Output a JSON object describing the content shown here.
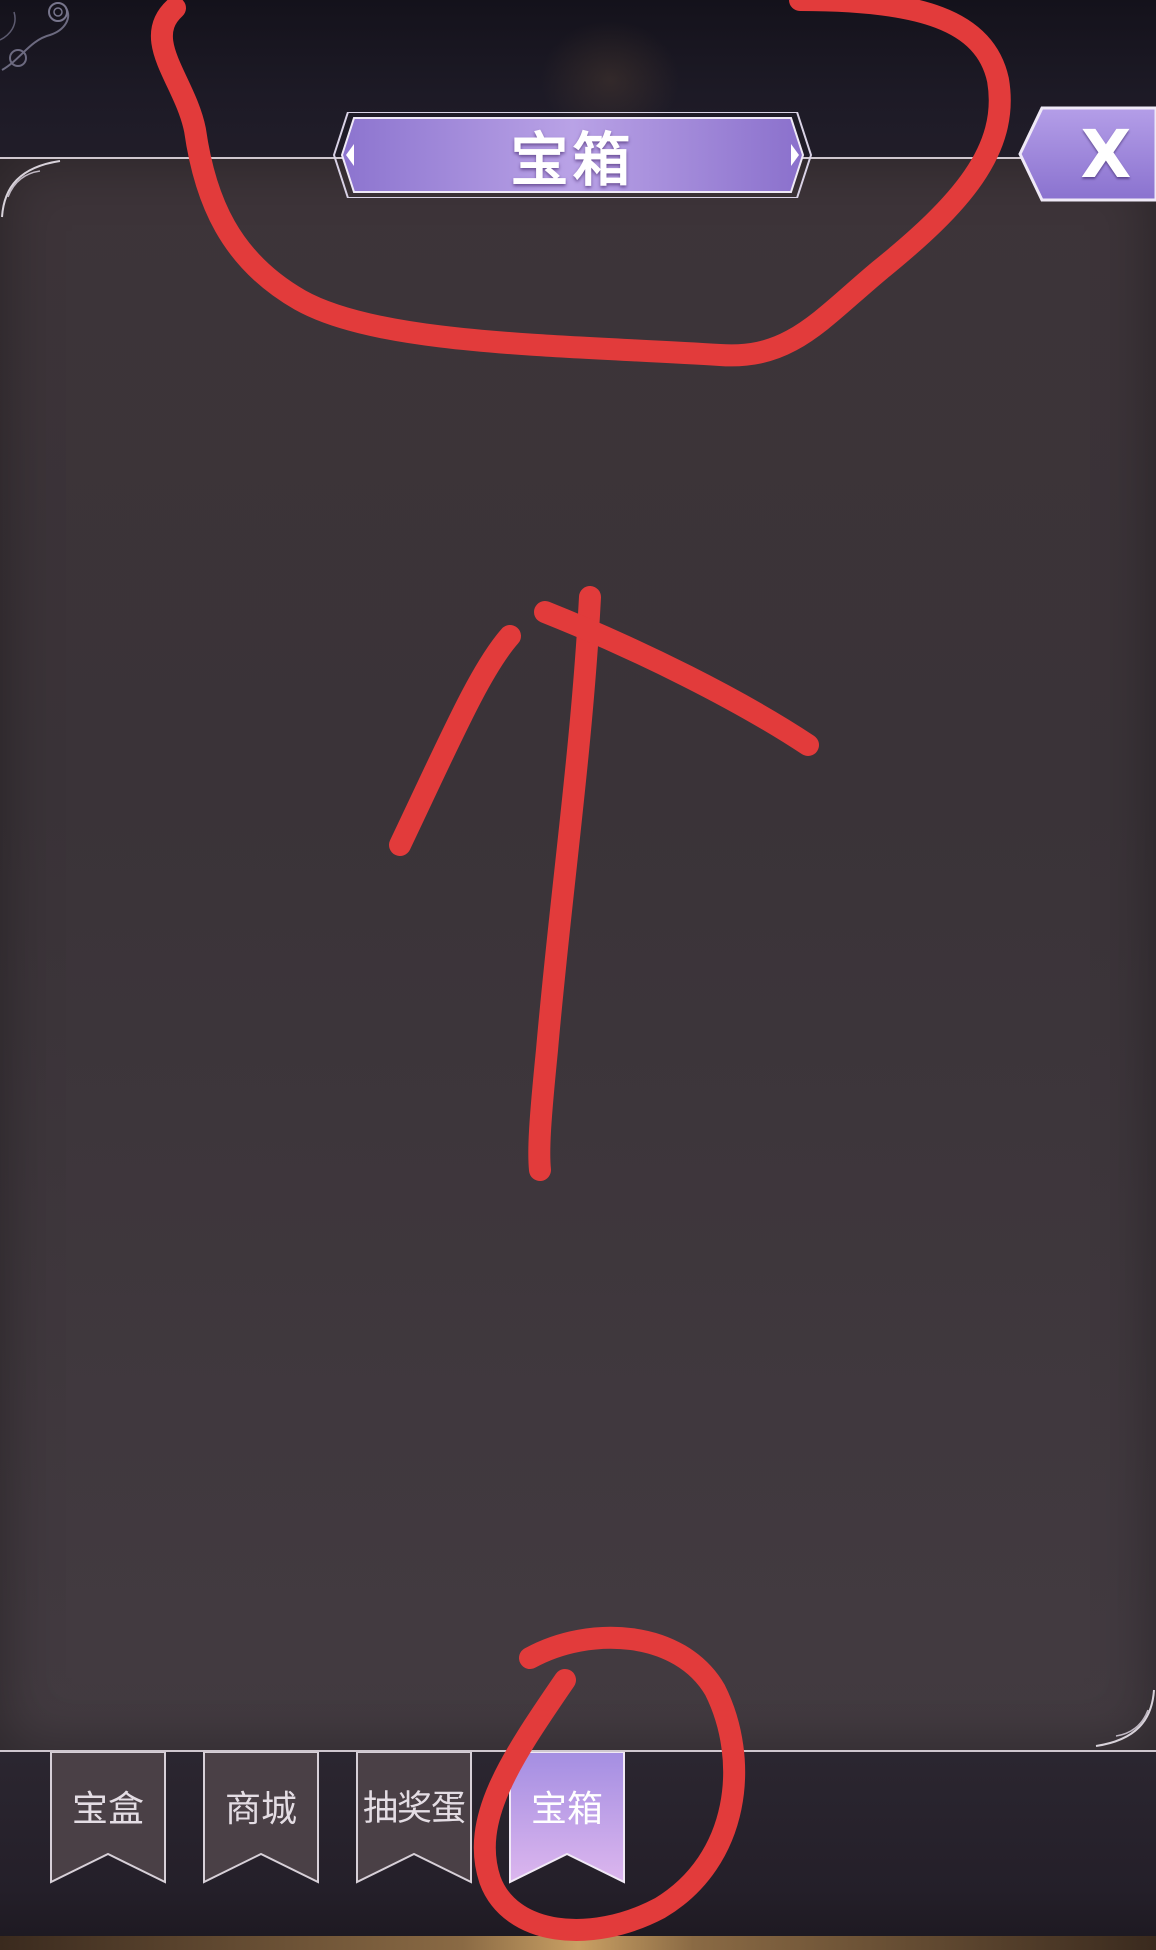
{
  "header": {
    "title": "宝箱",
    "close_label": "X"
  },
  "tabs": [
    {
      "label": "宝盒",
      "active": false
    },
    {
      "label": "商城",
      "active": false
    },
    {
      "label": "抽奖蛋",
      "active": false
    },
    {
      "label": "宝箱",
      "active": true
    }
  ],
  "annotation": {
    "color": "#e23b3b"
  },
  "theme": {
    "banner_purple": "#9a83d6",
    "panel": "#3d3439",
    "active_tab": "#c6a6ea"
  }
}
